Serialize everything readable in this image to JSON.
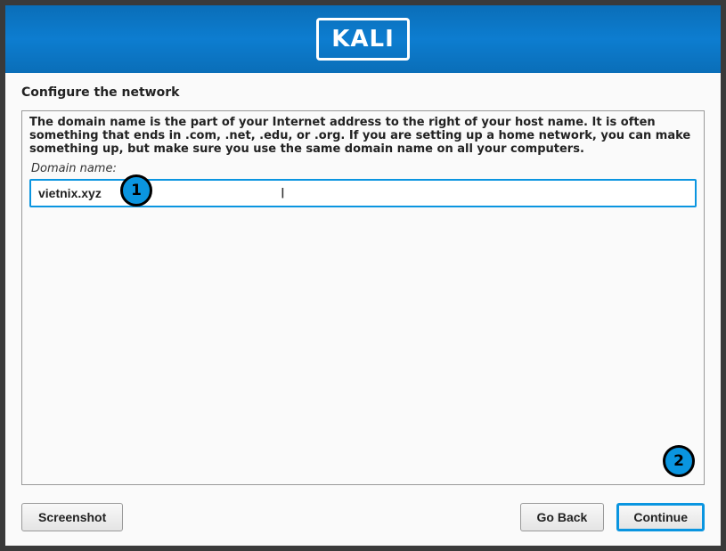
{
  "header": {
    "logo_text": "KALI"
  },
  "page": {
    "title": "Configure the network",
    "description": "The domain name is the part of your Internet address to the right of your host name.  It is often something that ends in .com, .net, .edu, or .org.  If you are setting up a home network, you can make something up, but make sure you use the same domain name on all your computers.",
    "field_label": "Domain name:",
    "domain_value": "vietnix.xyz"
  },
  "annotations": {
    "badge1": "1",
    "badge2": "2"
  },
  "footer": {
    "screenshot": "Screenshot",
    "go_back": "Go Back",
    "continue": "Continue"
  }
}
